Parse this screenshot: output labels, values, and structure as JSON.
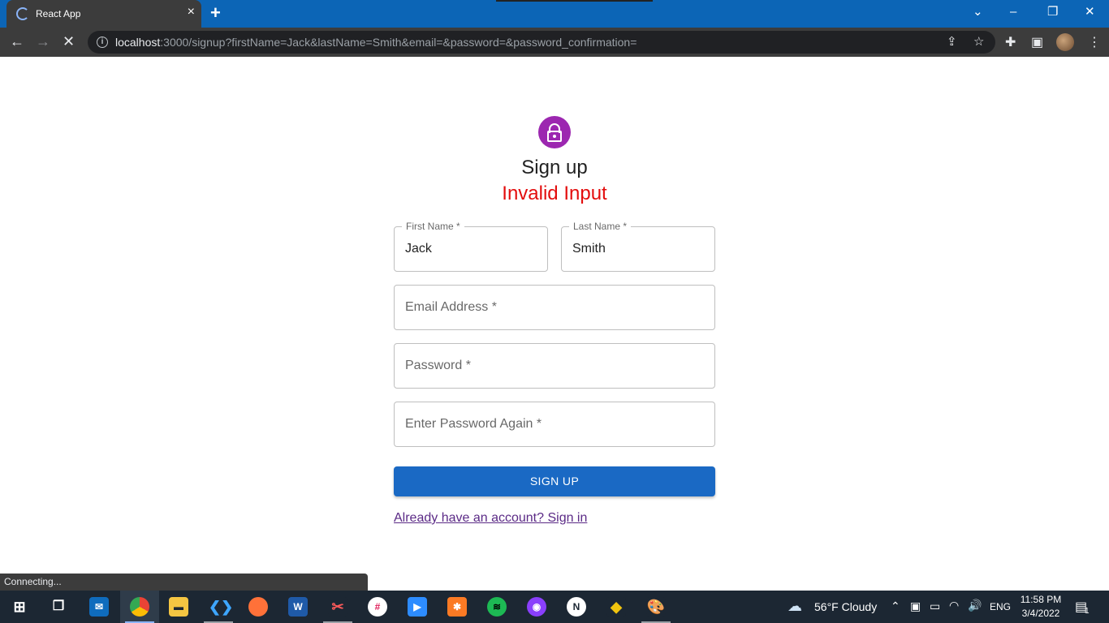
{
  "browser": {
    "tab_title": "React App",
    "new_tab_symbol": "+",
    "close_tab_symbol": "×",
    "window_controls": {
      "chevron": "⌄",
      "minimize": "–",
      "restore": "❐",
      "close": "✕"
    },
    "url_host": "localhost",
    "url_rest": ":3000/signup?firstName=Jack&lastName=Smith&email=&password=&password_confirmation=",
    "status_text": "Connecting..."
  },
  "page": {
    "title": "Sign up",
    "error": "Invalid Input",
    "fields": {
      "first_name": {
        "label": "First Name *",
        "value": "Jack"
      },
      "last_name": {
        "label": "Last Name *",
        "value": "Smith"
      },
      "email": {
        "placeholder": "Email Address *",
        "value": ""
      },
      "password": {
        "placeholder": "Password *",
        "value": ""
      },
      "password_confirm": {
        "placeholder": "Enter Password Again *",
        "value": ""
      }
    },
    "submit_label": "SIGN UP",
    "signin_link": "Already have an account? Sign in"
  },
  "taskbar": {
    "weather": "56°F  Cloudy",
    "language": "ENG",
    "time": "11:58 PM",
    "date": "3/4/2022",
    "notification_count": "1",
    "apps": [
      "start",
      "task-view",
      "mail",
      "chrome",
      "file-explorer",
      "vscode",
      "firefox",
      "word",
      "snipping-tool",
      "slack",
      "zoom",
      "xampp",
      "spotify",
      "podcast",
      "notion",
      "git",
      "paint"
    ]
  },
  "colors": {
    "accent_blue": "#1a69c4",
    "avatar_purple": "#9c27b0",
    "error_red": "#e30d0d",
    "link_purple": "#5b2a86",
    "titlebar_blue": "#0c65b6"
  }
}
